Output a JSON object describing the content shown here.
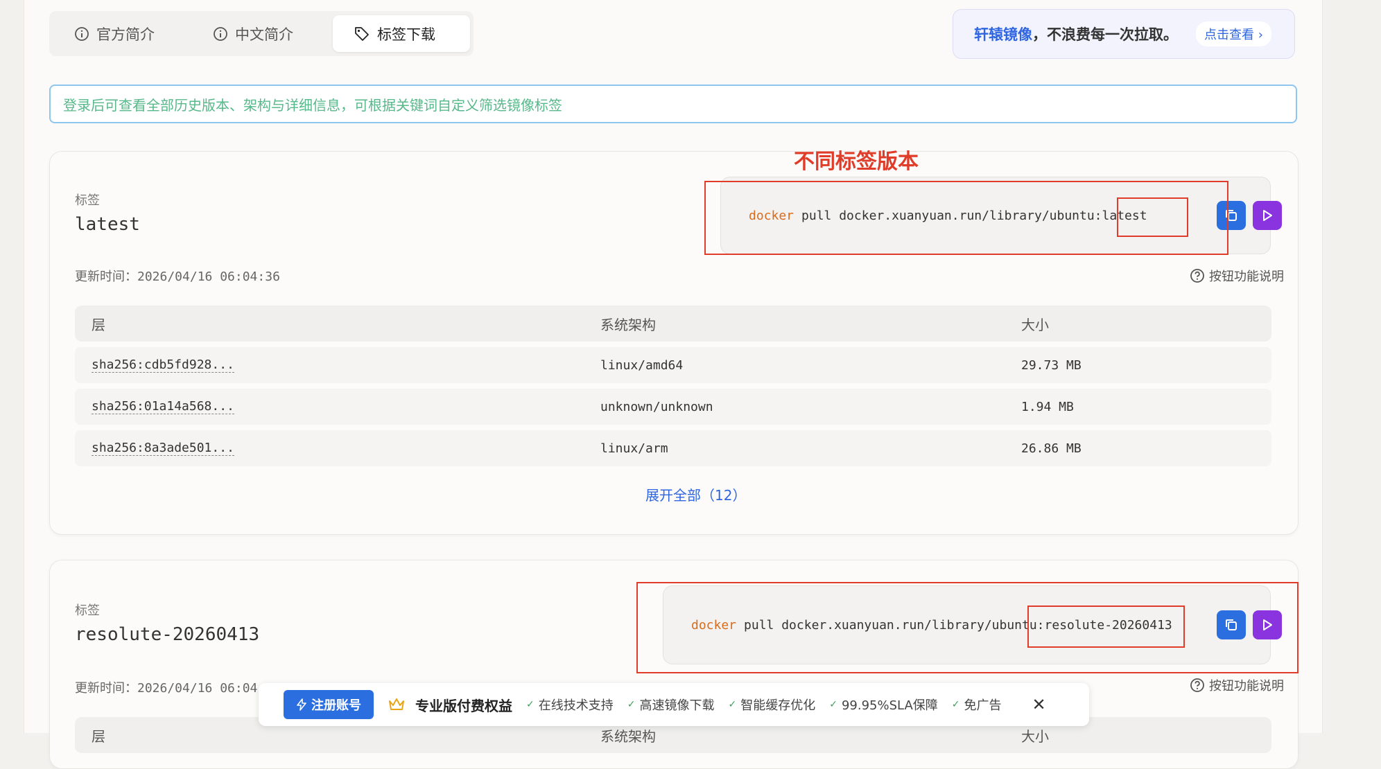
{
  "tabs": [
    {
      "label": "官方简介",
      "icon": "info-circle-icon",
      "active": false
    },
    {
      "label": "中文简介",
      "icon": "info-circle-icon",
      "active": false
    },
    {
      "label": "标签下载",
      "icon": "tag-icon",
      "active": true
    }
  ],
  "promo": {
    "brand": "轩辕镜像",
    "text": "，不浪费每一次拉取。",
    "link": "点击查看"
  },
  "search": {
    "placeholder": "登录后可查看全部历史版本、架构与详细信息，可根据关键词自定义筛选镜像标签"
  },
  "annotation": "不同标签版本",
  "cards": [
    {
      "label": "标签",
      "tag": "latest",
      "updated_label": "更新时间：",
      "updated": "2026/04/16 06:04:36",
      "cmd_kw": "docker",
      "cmd_rest": "pull docker.xuanyuan.run/library/ubuntu",
      "cmd_colon": ":",
      "cmd_tag": "latest",
      "help": "按钮功能说明",
      "columns": [
        "层",
        "系统架构",
        "大小"
      ],
      "rows": [
        {
          "digest": "sha256:cdb5fd928...",
          "arch": "linux/amd64",
          "size": "29.73 MB"
        },
        {
          "digest": "sha256:01a14a568...",
          "arch": "unknown/unknown",
          "size": "1.94 MB"
        },
        {
          "digest": "sha256:8a3ade501...",
          "arch": "linux/arm",
          "size": "26.86 MB"
        }
      ],
      "expand": "展开全部（12）"
    },
    {
      "label": "标签",
      "tag": "resolute-20260413",
      "updated_label": "更新时间：",
      "updated": "2026/04/16 06:04:36",
      "cmd_kw": "docker",
      "cmd_rest": "pull docker.xuanyuan.run/library/ubuntu",
      "cmd_colon": ":",
      "cmd_tag": "resolute-20260413",
      "help": "按钮功能说明",
      "columns": [
        "层",
        "系统架构",
        "大小"
      ]
    }
  ],
  "bottom_bar": {
    "register": "注册账号",
    "title": "专业版付费权益",
    "features": [
      "在线技术支持",
      "高速镜像下载",
      "智能缓存优化",
      "99.95%SLA保障",
      "免广告"
    ]
  },
  "colors": {
    "accent_blue": "#2b6ee0",
    "run_purple": "#8a34e0",
    "annotation_red": "#e03c2a",
    "placeholder_green": "#57b88a"
  }
}
